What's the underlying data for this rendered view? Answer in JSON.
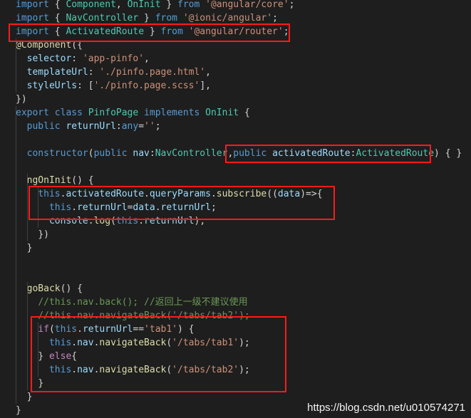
{
  "editor": {
    "lines": [
      "import { Component, OnInit } from '@angular/core';",
      "import { NavController } from '@ionic/angular';",
      "import { ActivatedRoute } from '@angular/router';",
      "@Component({",
      "  selector: 'app-pinfo',",
      "  templateUrl: './pinfo.page.html',",
      "  styleUrls: ['./pinfo.page.scss'],",
      "})",
      "export class PinfoPage implements OnInit {",
      "  public returnUrl:any='';",
      "",
      "  constructor(public nav:NavController,public activatedRoute:ActivatedRoute) { }",
      "",
      "  ngOnInit() {",
      "    this.activatedRoute.queryParams.subscribe((data)=>{",
      "      this.returnUrl=data.returnUrl;",
      "      console.log(this.returnUrl);",
      "    })",
      "  }",
      "",
      "",
      "  goBack() {",
      "    //this.nav.back(); //返回上一级不建议使用",
      "    //this.nav.navigateBack('/tabs/tab2');",
      "    if(this.returnUrl=='tab1') {",
      "      this.nav.navigateBack('/tabs/tab1');",
      "    } else{",
      "      this.nav.navigateBack('/tabs/tab2');",
      "    }",
      "  }",
      "}"
    ]
  },
  "watermark": "https://blog.csdn.net/u010574271",
  "colors": {
    "background": "#1e1e1e",
    "keyword": "#569cd6",
    "control": "#c586c0",
    "string": "#ce9178",
    "property": "#9cdcfe",
    "function": "#dcdcaa",
    "type": "#4ec9b0",
    "comment": "#6a9955",
    "highlight_box": "#ff1a1a"
  }
}
